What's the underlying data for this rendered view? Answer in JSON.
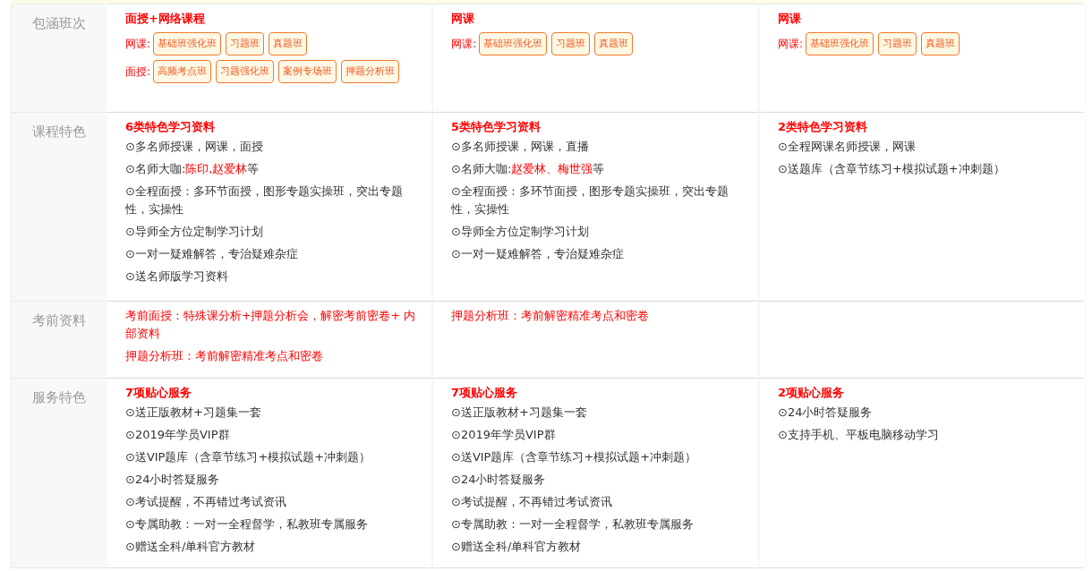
{
  "rows": [
    {
      "label": "包涵班次",
      "kind": "packages",
      "cells": [
        {
          "title": "面授+网络课程",
          "groups": [
            {
              "label": "网课:",
              "tags": [
                "基础班强化班",
                "习题班",
                "真题班"
              ]
            },
            {
              "label": "面授:",
              "tags": [
                "高频考点班",
                "习题强化班",
                "案例专场班",
                "押题分析班"
              ]
            }
          ]
        },
        {
          "title": "网课",
          "groups": [
            {
              "label": "网课:",
              "tags": [
                "基础班强化班",
                "习题班",
                "真题班"
              ]
            }
          ]
        },
        {
          "title": "网课",
          "groups": [
            {
              "label": "网课:",
              "tags": [
                "基础班强化班",
                "习题班",
                "真题班"
              ]
            }
          ]
        }
      ]
    },
    {
      "label": "课程特色",
      "kind": "features",
      "cells": [
        {
          "title": "6类特色学习资料",
          "items": [
            [
              {
                "text": "⊙多名师授课，网课，面授",
                "emphasis": false
              }
            ],
            [
              {
                "text": "⊙名师大咖:",
                "emphasis": false
              },
              {
                "text": "陈印,赵爱林",
                "emphasis": true
              },
              {
                "text": "等",
                "emphasis": false
              }
            ],
            [
              {
                "text": "⊙全程面授：多环节面授，图形专题实操班，突出专题性，实操性",
                "emphasis": false
              }
            ],
            [
              {
                "text": "⊙导师全方位定制学习计划",
                "emphasis": false
              }
            ],
            [
              {
                "text": "⊙一对一疑难解答，专治疑难杂症",
                "emphasis": false
              }
            ],
            [
              {
                "text": "⊙送名师版学习资料",
                "emphasis": false
              }
            ]
          ]
        },
        {
          "title": "5类特色学习资料",
          "items": [
            [
              {
                "text": "⊙多名师授课，网课，直播",
                "emphasis": false
              }
            ],
            [
              {
                "text": "⊙名师大咖:",
                "emphasis": false
              },
              {
                "text": "赵爱林、梅世强",
                "emphasis": true
              },
              {
                "text": "等",
                "emphasis": false
              }
            ],
            [
              {
                "text": "⊙全程面授：多环节面授，图形专题实操班，突出专题性，实操性",
                "emphasis": false
              }
            ],
            [
              {
                "text": "⊙导师全方位定制学习计划",
                "emphasis": false
              }
            ],
            [
              {
                "text": "⊙一对一疑难解答，专治疑难杂症",
                "emphasis": false
              }
            ]
          ]
        },
        {
          "title": "2类特色学习资料",
          "items": [
            [
              {
                "text": "⊙全程网课名师授课，网课",
                "emphasis": false
              }
            ],
            [
              {
                "text": "⊙送题库（含章节练习+模拟试题+冲刺题）",
                "emphasis": false
              }
            ]
          ]
        }
      ]
    },
    {
      "label": "考前资料",
      "kind": "notes",
      "cells": [
        {
          "notes": [
            "考前面授：特殊课分析+押题分析会，解密考前密卷+ 内部资料",
            "押题分析班：考前解密精准考点和密卷"
          ]
        },
        {
          "notes": [
            "押题分析班：考前解密精准考点和密卷"
          ]
        },
        {}
      ]
    },
    {
      "label": "服务特色",
      "kind": "features",
      "cells": [
        {
          "title": "7项贴心服务",
          "items": [
            [
              {
                "text": "⊙送正版教材+习题集一套",
                "emphasis": false
              }
            ],
            [
              {
                "text": "⊙2019年学员VIP群",
                "emphasis": false
              }
            ],
            [
              {
                "text": "⊙送VIP题库（含章节练习+模拟试题+冲刺题）",
                "emphasis": false
              }
            ],
            [
              {
                "text": "⊙24小时答疑服务",
                "emphasis": false
              }
            ],
            [
              {
                "text": "⊙考试提醒，不再错过考试资讯",
                "emphasis": false
              }
            ],
            [
              {
                "text": "⊙专属助教：一对一全程督学，私教班专属服务",
                "emphasis": false
              }
            ],
            [
              {
                "text": "⊙赠送全科/单科官方教材",
                "emphasis": false
              }
            ]
          ]
        },
        {
          "title": "7项贴心服务",
          "items": [
            [
              {
                "text": "⊙送正版教材+习题集一套",
                "emphasis": false
              }
            ],
            [
              {
                "text": "⊙2019年学员VIP群",
                "emphasis": false
              }
            ],
            [
              {
                "text": "⊙送VIP题库（含章节练习+模拟试题+冲刺题）",
                "emphasis": false
              }
            ],
            [
              {
                "text": "⊙24小时答疑服务",
                "emphasis": false
              }
            ],
            [
              {
                "text": "⊙考试提醒，不再错过考试资讯",
                "emphasis": false
              }
            ],
            [
              {
                "text": "⊙专属助教：一对一全程督学，私教班专属服务",
                "emphasis": false
              }
            ],
            [
              {
                "text": "⊙赠送全科/单科官方教材",
                "emphasis": false
              }
            ]
          ]
        },
        {
          "title": "2项贴心服务",
          "items": [
            [
              {
                "text": "⊙24小时答疑服务",
                "emphasis": false
              }
            ],
            [
              {
                "text": "⊙支持手机、平板电脑移动学习",
                "emphasis": false
              }
            ]
          ]
        }
      ]
    }
  ]
}
